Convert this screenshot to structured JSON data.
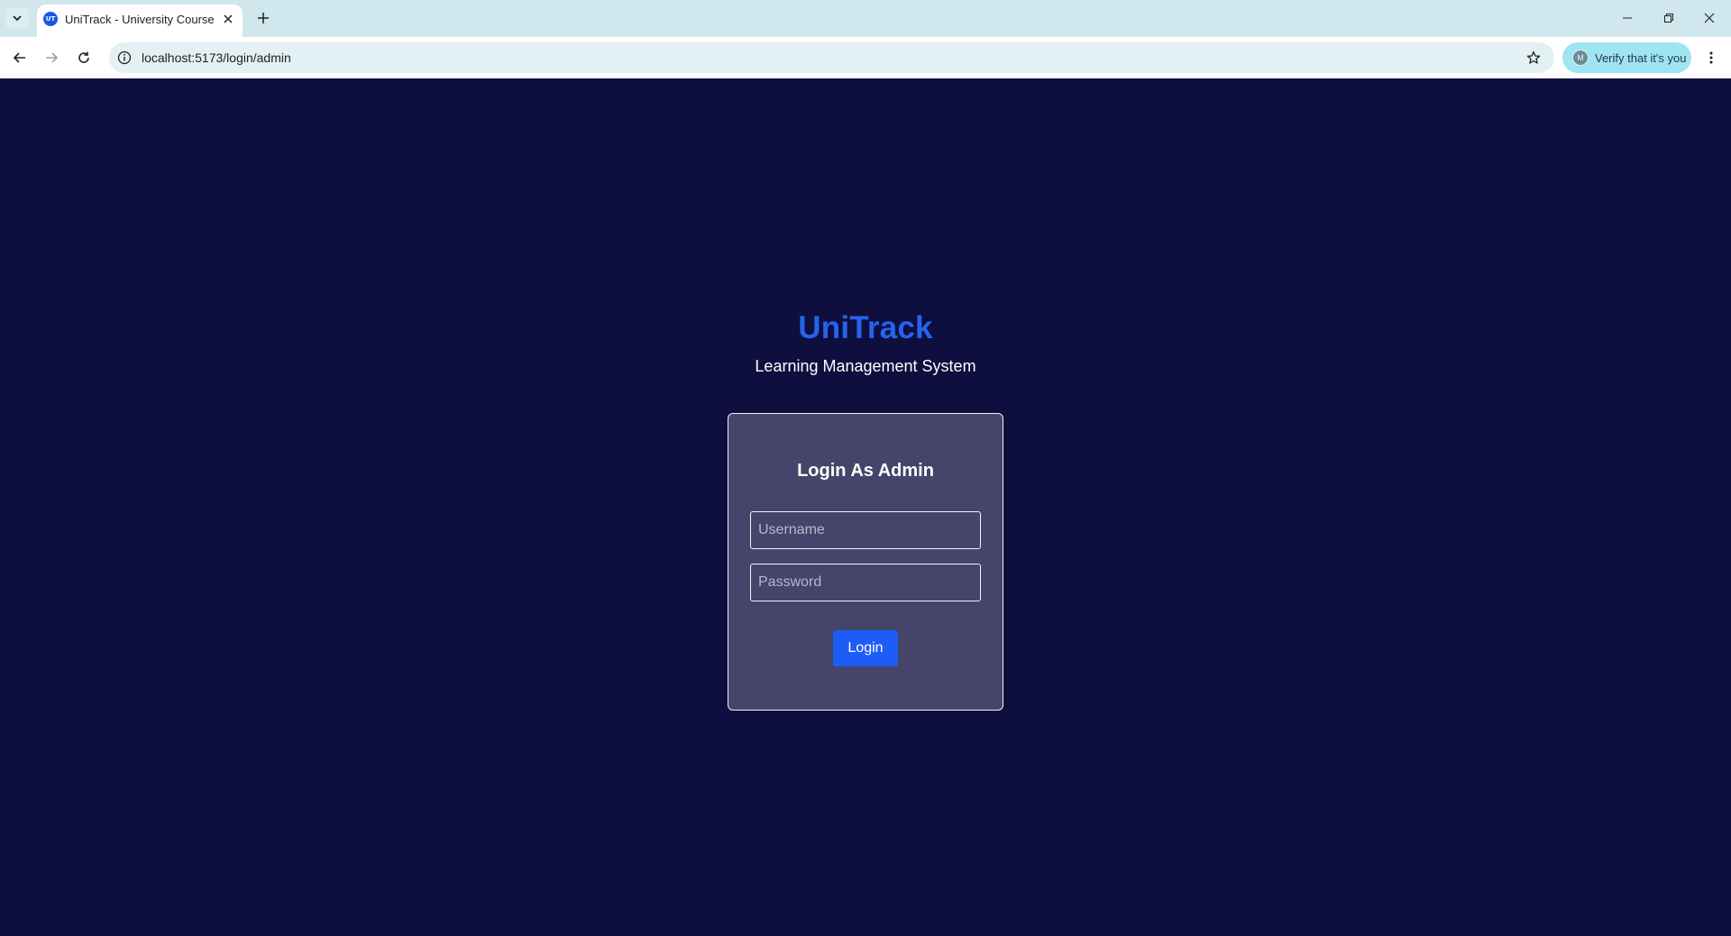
{
  "browser": {
    "tab": {
      "favicon_text": "UT",
      "title": "UniTrack - University Course M"
    },
    "address_bar": {
      "url": "localhost:5173/login/admin"
    },
    "profile_chip": {
      "avatar_letter": "M",
      "label": "Verify that it's you"
    },
    "icons": {
      "tab_list": "chevron-down-icon",
      "tab_close": "close-icon",
      "new_tab": "plus-icon",
      "back": "arrow-left-icon",
      "forward": "arrow-right-icon",
      "reload": "reload-icon",
      "site_info": "info-icon",
      "bookmark": "star-icon",
      "menu": "kebab-menu-icon",
      "minimize": "minimize-icon",
      "restore": "restore-icon",
      "close_window": "close-icon"
    }
  },
  "page": {
    "brand": "UniTrack",
    "tagline": "Learning Management System",
    "login_card": {
      "title": "Login As Admin",
      "username": {
        "value": "",
        "placeholder": "Username"
      },
      "password": {
        "value": "",
        "placeholder": "Password"
      },
      "submit_label": "Login"
    }
  },
  "colors": {
    "page_background": "#0e0e3f",
    "brand": "#2563eb",
    "card_background": "#45446a",
    "button": "#1d5cf5",
    "tabbar": "#cfe7ed",
    "verify_chip": "#9fe4f2"
  }
}
